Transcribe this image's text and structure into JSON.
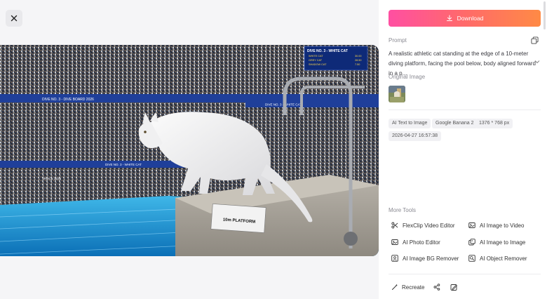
{
  "header": {
    "close_icon": "close-icon"
  },
  "preview": {
    "scene_text": {
      "board_title": "DIVE NO. 3 - WHITE CAT",
      "board_rows": [
        {
          "name": "WHITE CAT",
          "score": "30.00"
        },
        {
          "name": "GREY CAT",
          "score": "28.50"
        },
        {
          "name": "SHADOW CAT",
          "score": "7.50"
        }
      ],
      "banner_left": "DIVE NO. 3 - DIVE BOARD 2026",
      "banner_mid": "DIVE NO. 3 - WHITE CAT",
      "sign": "10m PLATFORM",
      "ad_left": "TRIALS 2026",
      "ad_mid": "DIVE NO. 3 - WHITE CAT"
    }
  },
  "panel": {
    "download_label": "Download",
    "prompt_label": "Prompt",
    "prompt_text": "A realistic athletic cat standing at the edge of a 10-meter diving platform, facing the pool below, body aligned forward in a p...",
    "original_image_label": "Original Image",
    "tags": [
      "AI Text to Image",
      "Google Banana 2",
      "1376 * 768 px",
      "2026-04-27 16:57:38"
    ],
    "more_tools_label": "More Tools",
    "tools": [
      {
        "label": "FlexClip Video Editor",
        "icon": "scissors-icon"
      },
      {
        "label": "AI Image to Video",
        "icon": "image-video-icon"
      },
      {
        "label": "AI Photo Editor",
        "icon": "photo-edit-icon"
      },
      {
        "label": "AI Image to Image",
        "icon": "image-image-icon"
      },
      {
        "label": "AI Image BG Remover",
        "icon": "bg-remove-icon"
      },
      {
        "label": "AI Object Remover",
        "icon": "object-remove-icon"
      }
    ],
    "recreate_label": "Recreate",
    "colors": {
      "download_start": "#ff4fa2",
      "download_end": "#ff8a45"
    }
  }
}
